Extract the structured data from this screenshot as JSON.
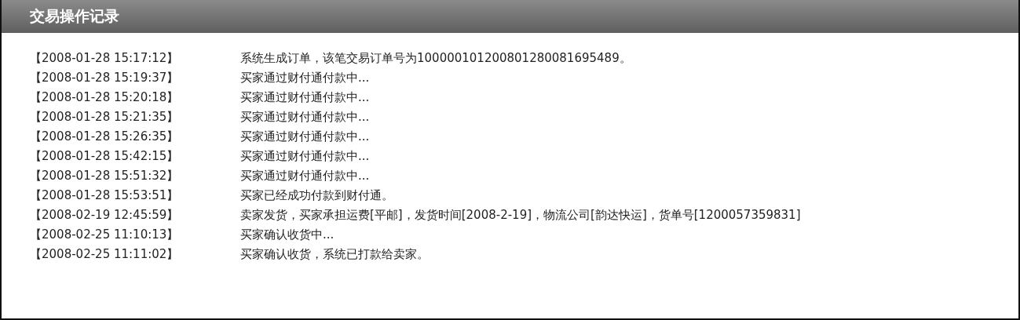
{
  "panel": {
    "title": "交易操作记录"
  },
  "records": [
    {
      "time": "【2008-01-28 15:17:12】",
      "message": "系统生成订单，该笔交易订单号为100000101200801280081695489。"
    },
    {
      "time": "【2008-01-28 15:19:37】",
      "message": "买家通过财付通付款中..."
    },
    {
      "time": "【2008-01-28 15:20:18】",
      "message": "买家通过财付通付款中..."
    },
    {
      "time": "【2008-01-28 15:21:35】",
      "message": "买家通过财付通付款中..."
    },
    {
      "time": "【2008-01-28 15:26:35】",
      "message": "买家通过财付通付款中..."
    },
    {
      "time": "【2008-01-28 15:42:15】",
      "message": "买家通过财付通付款中..."
    },
    {
      "time": "【2008-01-28 15:51:32】",
      "message": "买家通过财付通付款中..."
    },
    {
      "time": "【2008-01-28 15:53:51】",
      "message": "买家已经成功付款到财付通。"
    },
    {
      "time": "【2008-02-19 12:45:59】",
      "message": "卖家发货，买家承担运费[平邮]，发货时间[2008-2-19]，物流公司[韵达快运]，货单号[1200057359831]"
    },
    {
      "time": "【2008-02-25 11:10:13】",
      "message": "买家确认收货中..."
    },
    {
      "time": "【2008-02-25 11:11:02】",
      "message": "买家确认收货，系统已打款给卖家。"
    }
  ]
}
